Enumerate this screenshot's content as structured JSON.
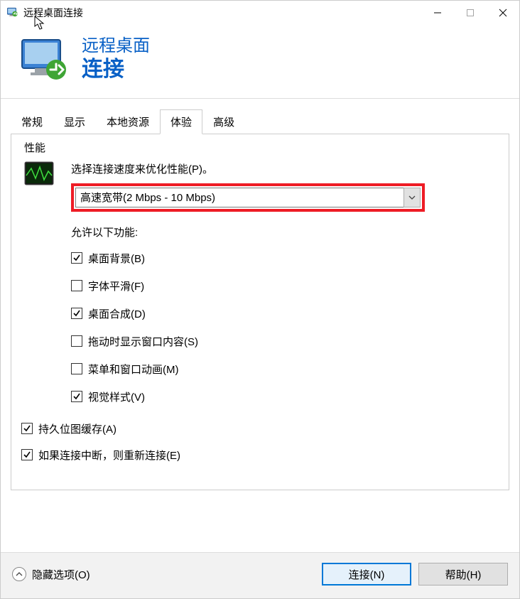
{
  "titlebar": {
    "title": "远程桌面连接"
  },
  "header": {
    "line1": "远程桌面",
    "line2": "连接"
  },
  "tabs": {
    "general": "常规",
    "display": "显示",
    "local_resources": "本地资源",
    "experience": "体验",
    "advanced": "高级"
  },
  "groupbox": {
    "title": "性能",
    "perf_label": "选择连接速度来优化性能(P)。",
    "dropdown_value": "高速宽带(2 Mbps - 10 Mbps)",
    "allow_label": "允许以下功能:"
  },
  "checkboxes": {
    "desktop_bg": {
      "label": "桌面背景(B)",
      "checked": true
    },
    "font_smoothing": {
      "label": "字体平滑(F)",
      "checked": false
    },
    "desktop_composition": {
      "label": "桌面合成(D)",
      "checked": true
    },
    "show_window_contents": {
      "label": "拖动时显示窗口内容(S)",
      "checked": false
    },
    "menu_anim": {
      "label": "菜单和窗口动画(M)",
      "checked": false
    },
    "visual_styles": {
      "label": "视觉样式(V)",
      "checked": true
    }
  },
  "bottom_checks": {
    "bitmap_caching": {
      "label": "持久位图缓存(A)",
      "checked": true
    },
    "reconnect": {
      "label": "如果连接中断，则重新连接(E)",
      "checked": true
    }
  },
  "footer": {
    "hide_options": "隐藏选项(O)",
    "connect": "连接(N)",
    "help": "帮助(H)"
  }
}
